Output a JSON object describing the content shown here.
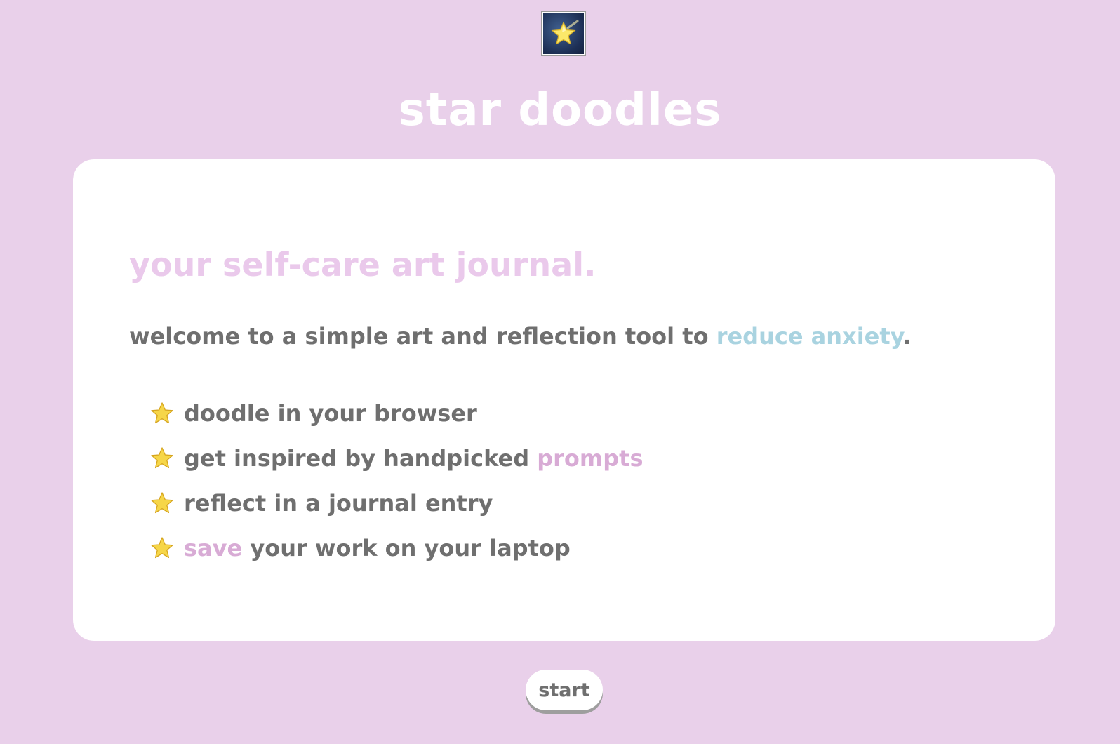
{
  "header": {
    "logo_icon": "shooting-star-icon",
    "title": "star doodles"
  },
  "card": {
    "tagline": "your self-care art journal.",
    "welcome": {
      "prefix": "welcome to a simple art and reflection tool to ",
      "highlight": "reduce anxiety",
      "suffix": "."
    },
    "features": [
      {
        "icon": "star-icon",
        "before": "doodle in your browser",
        "highlight": "",
        "after": ""
      },
      {
        "icon": "star-icon",
        "before": "get inspired by handpicked ",
        "highlight": "prompts",
        "after": ""
      },
      {
        "icon": "star-icon",
        "before": "reflect in a journal entry",
        "highlight": "",
        "after": ""
      },
      {
        "icon": "star-icon",
        "before": "",
        "highlight": "save",
        "after": " your work on your laptop"
      }
    ]
  },
  "actions": {
    "start_label": "start"
  },
  "colors": {
    "background": "#e9d0ea",
    "card": "#ffffff",
    "tagline": "#eac9eb",
    "body_text": "#6f6f6f",
    "accent_blue": "#a9d3e0",
    "accent_pink": "#d8abd5",
    "star": "#f6d648"
  }
}
